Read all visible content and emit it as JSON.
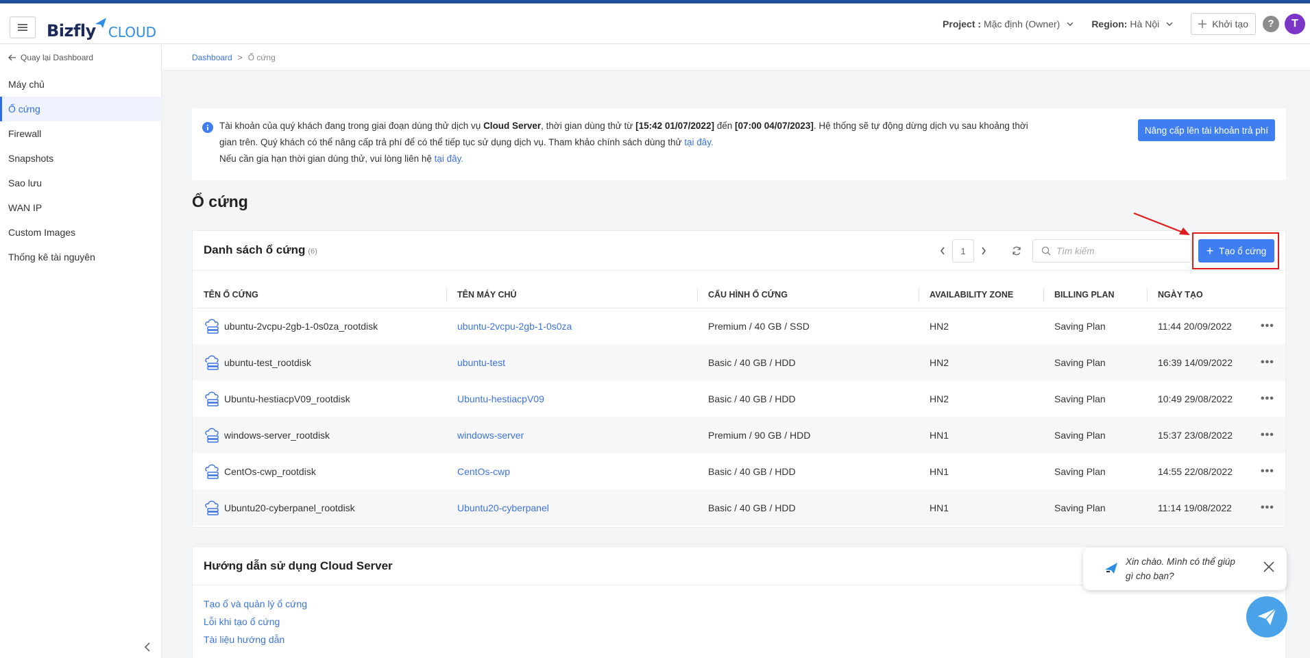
{
  "header": {
    "logo_main": "Bizfly",
    "logo_sub": "CLOUD",
    "project_label": "Project :",
    "project_value": "Mặc định (Owner)",
    "region_label": "Region:",
    "region_value": "Hà Nội",
    "create_label": "Khởi tạo",
    "help_label": "?",
    "avatar_letter": "T"
  },
  "sidebar": {
    "back_label": "Quay lại Dashboard",
    "items": [
      {
        "label": "Máy chủ"
      },
      {
        "label": "Ổ cứng"
      },
      {
        "label": "Firewall"
      },
      {
        "label": "Snapshots"
      },
      {
        "label": "Sao lưu"
      },
      {
        "label": "WAN IP"
      },
      {
        "label": "Custom Images"
      },
      {
        "label": "Thống kê tài nguyên"
      }
    ]
  },
  "breadcrumb": {
    "root": "Dashboard",
    "sep": ">",
    "current": "Ổ cứng"
  },
  "notice": {
    "p1": "Tài khoản của quý khách đang trong giai đoạn dùng thử dịch vụ ",
    "service": "Cloud Server",
    "p2": ", thời gian dùng thử từ ",
    "start": "[15:42 01/07/2022]",
    "p3": " đến ",
    "end": "[07:00 04/07/2023]",
    "p4": ". Hệ thống sẽ tự động dừng dịch vụ sau khoảng thời gian trên. Quý khách có thể nâng cấp trả phí để có thể tiếp tục sử dụng dịch vụ. Tham khảo chính sách dùng thử ",
    "link1": "tại đây.",
    "p5": "Nếu cần gia hạn thời gian dùng thử, vui lòng liên hệ ",
    "link2": "tại đây.",
    "upgrade_label": "Nâng cấp lên tài khoản trả phí"
  },
  "page_title": "Ổ cứng",
  "disk_list": {
    "title": "Danh sách ổ cứng",
    "count": "(6)",
    "page": "1",
    "search_placeholder": "Tìm kiếm",
    "add_label": "Tạo ổ cứng",
    "columns": [
      "TÊN Ổ CỨNG",
      "TÊN MÁY CHỦ",
      "CẤU HÌNH Ổ CỨNG",
      "AVAILABILITY ZONE",
      "BILLING PLAN",
      "NGÀY TẠO"
    ],
    "rows": [
      {
        "name": "ubuntu-2vcpu-2gb-1-0s0za_rootdisk",
        "server": "ubuntu-2vcpu-2gb-1-0s0za",
        "config": "Premium / 40 GB / SSD",
        "zone": "HN2",
        "plan": "Saving Plan",
        "created": "11:44 20/09/2022",
        "more": "•••"
      },
      {
        "name": "ubuntu-test_rootdisk",
        "server": "ubuntu-test",
        "config": "Basic / 40 GB / HDD",
        "zone": "HN2",
        "plan": "Saving Plan",
        "created": "16:39 14/09/2022",
        "more": "•••"
      },
      {
        "name": "Ubuntu-hestiacpV09_rootdisk",
        "server": "Ubuntu-hestiacpV09",
        "config": "Basic / 40 GB / HDD",
        "zone": "HN2",
        "plan": "Saving Plan",
        "created": "10:49 29/08/2022",
        "more": "•••"
      },
      {
        "name": "windows-server_rootdisk",
        "server": "windows-server",
        "config": "Premium / 90 GB / HDD",
        "zone": "HN1",
        "plan": "Saving Plan",
        "created": "15:37 23/08/2022",
        "more": "•••"
      },
      {
        "name": "CentOs-cwp_rootdisk",
        "server": "CentOs-cwp",
        "config": "Basic / 40 GB / HDD",
        "zone": "HN1",
        "plan": "Saving Plan",
        "created": "14:55 22/08/2022",
        "more": "•••"
      },
      {
        "name": "Ubuntu20-cyberpanel_rootdisk",
        "server": "Ubuntu20-cyberpanel",
        "config": "Basic / 40 GB / HDD",
        "zone": "HN1",
        "plan": "Saving Plan",
        "created": "11:14 19/08/2022",
        "more": "•••"
      }
    ]
  },
  "guide": {
    "title": "Hướng dẫn sử dụng Cloud Server",
    "links": [
      {
        "label": "Tạo ổ và quản lý ổ cứng"
      },
      {
        "label": "Lỗi khi tạo ổ cứng"
      },
      {
        "label": "Tài liệu hướng dẫn"
      }
    ]
  },
  "chat": {
    "message": "Xin chào. Mình có thể giúp gì cho bạn?"
  },
  "colors": {
    "accent": "#3f7ef1",
    "link": "#3b73df",
    "highlight": "#e01b1b",
    "avatar": "#7b35c7"
  },
  "icons": [
    "menu-icon",
    "chevron-down-icon",
    "plus-icon",
    "arrow-left-icon",
    "info-icon",
    "chevron-left-icon",
    "chevron-right-icon",
    "refresh-icon",
    "search-icon",
    "disk-icon",
    "more-icon",
    "close-icon",
    "send-icon"
  ]
}
